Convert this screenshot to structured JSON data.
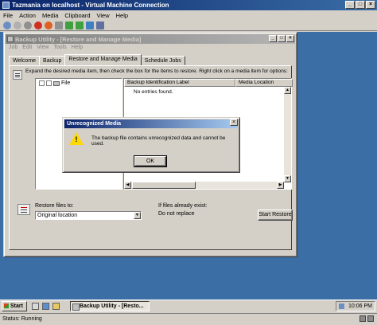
{
  "vm": {
    "title": "Tazmania on localhost - Virtual Machine Connection",
    "menu": [
      "File",
      "Action",
      "Media",
      "Clipboard",
      "View",
      "Help"
    ],
    "status": "Status: Running"
  },
  "backup": {
    "title": "Backup Utility - [Restore and Manage Media]",
    "menu": [
      "Job",
      "Edit",
      "View",
      "Tools",
      "Help"
    ],
    "tabs": [
      "Welcome",
      "Backup",
      "Restore and Manage Media",
      "Schedule Jobs"
    ],
    "instruction": "Expand the desired media item, then check the box for the items to restore. Right click on a media item for options:",
    "tree_item": "File",
    "columns": [
      "Backup Identification Label",
      "Media Location"
    ],
    "empty_text": "No entries found.",
    "restore_to_label": "Restore files to:",
    "restore_to_value": "Original location",
    "if_exists_label": "If files already exist:",
    "if_exists_value": "Do not replace",
    "start_restore": "Start Restore"
  },
  "dialog": {
    "title": "Unrecognized Media",
    "message": "The backup file contains unrecognized data and cannot be used.",
    "ok": "OK"
  },
  "taskbar": {
    "start": "Start",
    "task": "Backup Utility - [Resto...",
    "time": "10:06 PM"
  }
}
